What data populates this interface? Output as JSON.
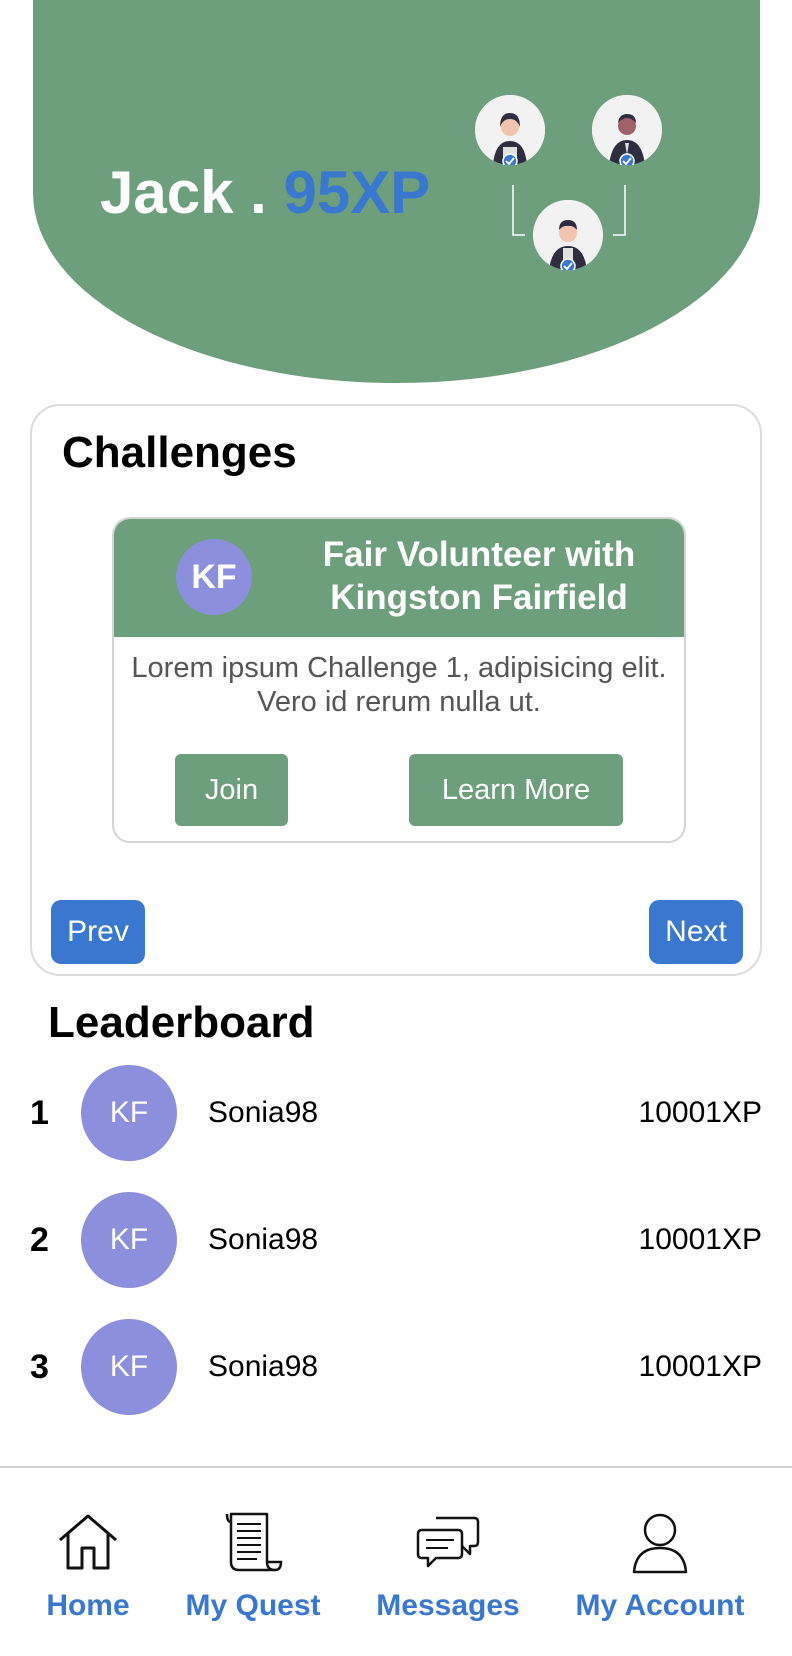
{
  "hero": {
    "name": "Jack .",
    "xp": "95XP"
  },
  "challenges": {
    "title": "Challenges",
    "card": {
      "avatar_initials": "KF",
      "title_line1": "Fair Volunteer with",
      "title_line2": "Kingston Fairfield",
      "desc_line1": "Lorem ipsum Challenge 1, adipisicing elit.",
      "desc_line2": "Vero id rerum nulla ut.",
      "join_label": "Join",
      "learn_more_label": "Learn More"
    },
    "prev_label": "Prev",
    "next_label": "Next"
  },
  "leaderboard": {
    "title": "Leaderboard",
    "rows": [
      {
        "rank": "1",
        "initials": "KF",
        "name": "Sonia98",
        "xp": "10001XP"
      },
      {
        "rank": "2",
        "initials": "KF",
        "name": "Sonia98",
        "xp": "10001XP"
      },
      {
        "rank": "3",
        "initials": "KF",
        "name": "Sonia98",
        "xp": "10001XP"
      }
    ]
  },
  "nav": {
    "items": [
      {
        "label": "Home",
        "icon": "home-icon"
      },
      {
        "label": "My Quest",
        "icon": "scroll-icon"
      },
      {
        "label": "Messages",
        "icon": "chat-icon"
      },
      {
        "label": "My Account",
        "icon": "user-icon"
      }
    ]
  },
  "colors": {
    "green": "#6e9f7c",
    "blue": "#3a78cf",
    "avatar_purple": "#8c90dc"
  }
}
